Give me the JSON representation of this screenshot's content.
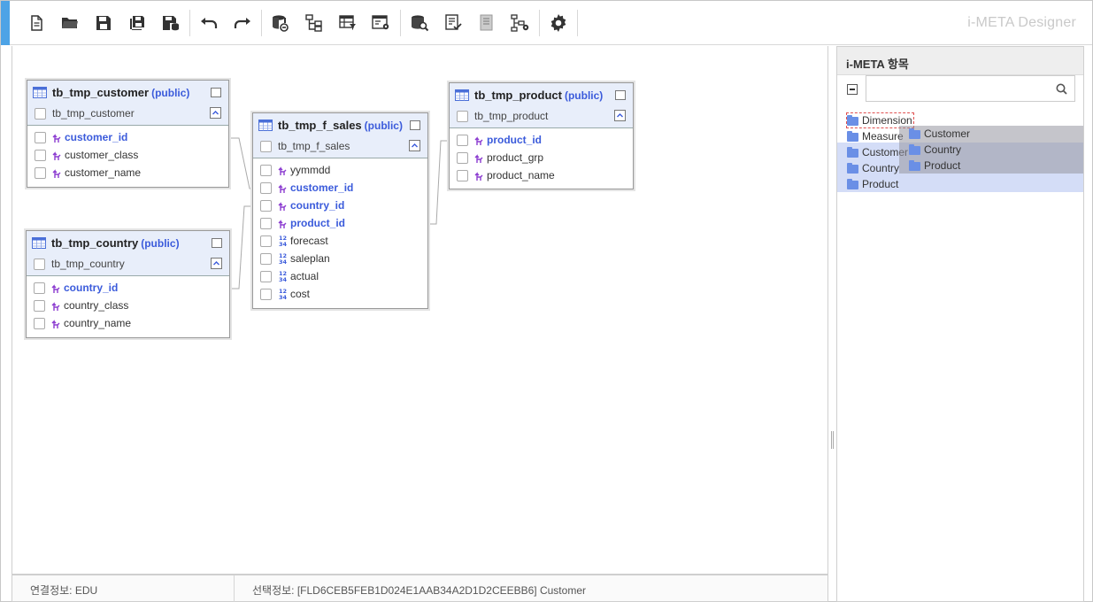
{
  "app": {
    "title": "i-META Designer"
  },
  "toolbar": {
    "buttons": [
      "new-file-icon",
      "open-folder-icon",
      "save-icon",
      "save-all-icon",
      "save-db-icon",
      "undo-icon",
      "redo-icon",
      "db-link-icon",
      "hierarchy-icon",
      "table-filter-icon",
      "window-settings-icon",
      "db-search-icon",
      "checklist-icon",
      "document-icon",
      "tree-settings-icon",
      "gear-icon"
    ]
  },
  "tables": [
    {
      "id": "customer",
      "name": "tb_tmp_customer",
      "schema": "(public)",
      "alias": "tb_tmp_customer",
      "columns": [
        {
          "name": "customer_id",
          "type": "key"
        },
        {
          "name": "customer_class",
          "type": "key"
        },
        {
          "name": "customer_name",
          "type": "key"
        }
      ]
    },
    {
      "id": "country",
      "name": "tb_tmp_country",
      "schema": "(public)",
      "alias": "tb_tmp_country",
      "columns": [
        {
          "name": "country_id",
          "type": "key"
        },
        {
          "name": "country_class",
          "type": "key"
        },
        {
          "name": "country_name",
          "type": "key"
        }
      ]
    },
    {
      "id": "f_sales",
      "name": "tb_tmp_f_sales",
      "schema": "(public)",
      "alias": "tb_tmp_f_sales",
      "columns": [
        {
          "name": "yymmdd",
          "type": "key"
        },
        {
          "name": "customer_id",
          "type": "key"
        },
        {
          "name": "country_id",
          "type": "key"
        },
        {
          "name": "product_id",
          "type": "key"
        },
        {
          "name": "forecast",
          "type": "num"
        },
        {
          "name": "saleplan",
          "type": "num"
        },
        {
          "name": "actual",
          "type": "num"
        },
        {
          "name": "cost",
          "type": "num"
        }
      ]
    },
    {
      "id": "product",
      "name": "tb_tmp_product",
      "schema": "(public)",
      "alias": "tb_tmp_product",
      "columns": [
        {
          "name": "product_id",
          "type": "key"
        },
        {
          "name": "product_grp",
          "type": "key"
        },
        {
          "name": "product_name",
          "type": "key"
        }
      ]
    }
  ],
  "status": {
    "connection": "연결정보: EDU",
    "selection": "선택정보: [FLD6CEB5FEB1D024E1AAB34A2D1D2CEEBB6] Customer"
  },
  "right_panel": {
    "title": "i-META 항목",
    "search_placeholder": "",
    "tree": [
      "Dimension",
      "Measure",
      "Customer",
      "Country",
      "Product"
    ],
    "drag_ghost": [
      "Customer",
      "Country",
      "Product"
    ]
  },
  "colors": {
    "accent": "#4da3e6",
    "key_blue": "#3b5bdb",
    "folder": "#6a8fe6",
    "highlight": "#d4ddf7"
  }
}
